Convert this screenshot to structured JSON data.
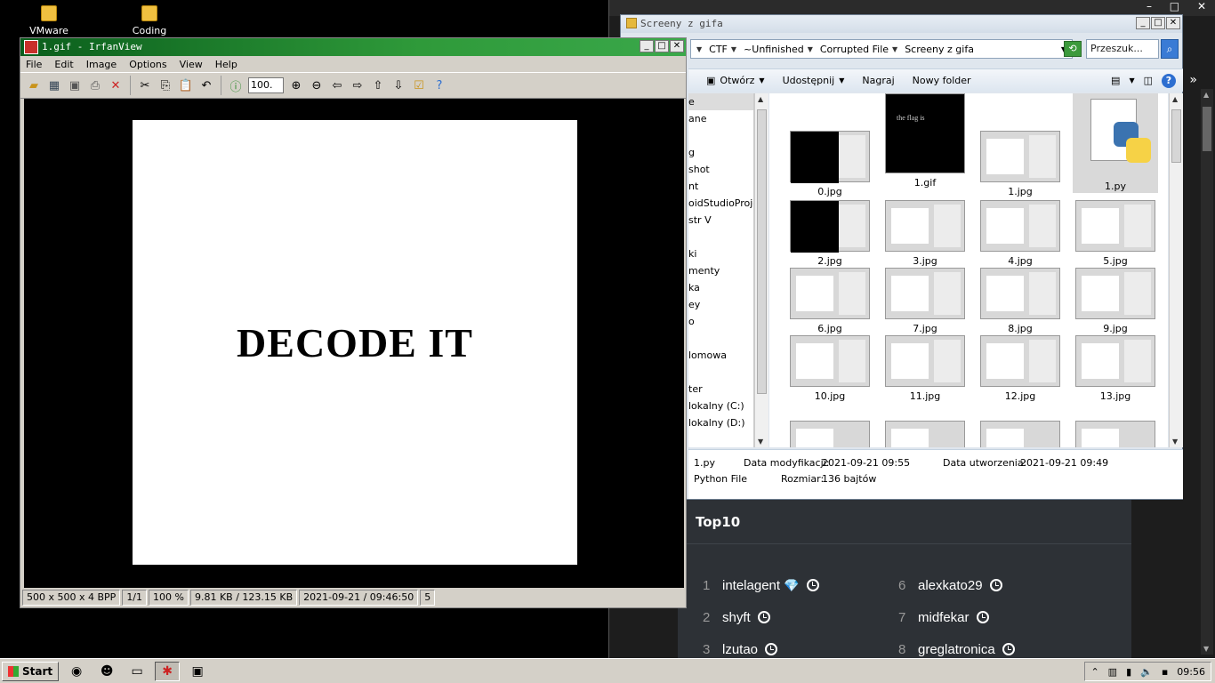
{
  "desktop": {
    "icons": [
      {
        "label": "VMware Workstation"
      },
      {
        "label": "Coding"
      }
    ]
  },
  "irfanview": {
    "title": "1.gif - IrfanView",
    "menu": [
      "File",
      "Edit",
      "Image",
      "Options",
      "View",
      "Help"
    ],
    "zoom_value": "100.",
    "image_text": "DECODE IT",
    "status": [
      "500 x 500 x 4 BPP",
      "1/1",
      "100 %",
      "9.81 KB / 123.15 KB",
      "2021-09-21 / 09:46:50",
      "5"
    ]
  },
  "explorer": {
    "title": "Screeny z gifa",
    "breadcrumb": [
      "CTF",
      "~Unfinished",
      "Corrupted File",
      "Screeny z gifa"
    ],
    "search_placeholder": "Przeszuk...",
    "toolbar": {
      "open": "Otwórz",
      "share": "Udostępnij",
      "burn": "Nagraj",
      "new_folder": "Nowy folder"
    },
    "nav_items": [
      "e",
      "ane",
      "",
      "g",
      "shot",
      "nt",
      "oidStudioProjec",
      "str V",
      "",
      "ki",
      "menty",
      "ka",
      "ey",
      "o",
      "",
      "lomowa",
      "",
      "ter",
      "lokalny (C:)",
      "lokalny (D:)"
    ],
    "files": [
      "0.jpg",
      "1.gif",
      "1.jpg",
      "1.py",
      "2.jpg",
      "3.jpg",
      "4.jpg",
      "5.jpg",
      "6.jpg",
      "7.jpg",
      "8.jpg",
      "9.jpg",
      "10.jpg",
      "11.jpg",
      "12.jpg",
      "13.jpg"
    ],
    "gif_thumb_text": "the flag is",
    "details": {
      "name": "1.py",
      "type": "Python File",
      "modified_label": "Data modyfikacji:",
      "modified_value": "2021-09-21 09:55",
      "created_label": "Data utworzenia:",
      "created_value": "2021-09-21 09:49",
      "size_label": "Rozmiar:",
      "size_value": "136 bajtów"
    }
  },
  "browser_bg": {
    "top10_title": "Top10",
    "left": [
      {
        "rank": "1",
        "name": "intelagent"
      },
      {
        "rank": "2",
        "name": "shyft"
      },
      {
        "rank": "3",
        "name": "lzutao"
      }
    ],
    "right": [
      {
        "rank": "6",
        "name": "alexkato29"
      },
      {
        "rank": "7",
        "name": "midfekar"
      },
      {
        "rank": "8",
        "name": "greglatronica"
      }
    ]
  },
  "taskbar": {
    "start_label": "Start",
    "clock": "09:56"
  },
  "colors": {
    "irfan_title": "#1f7a2c",
    "top10_bg": "#2d3136",
    "gem": "#5fc7e8"
  }
}
